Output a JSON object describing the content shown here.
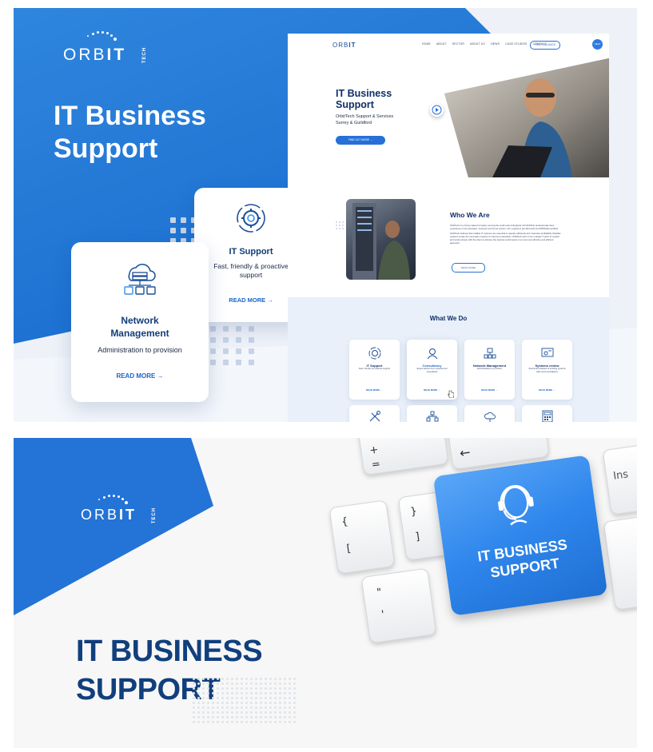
{
  "brand": {
    "logo_word": "ORB",
    "logo_it": "IT",
    "logo_suffix": "TECH"
  },
  "panel1": {
    "hero_title": "IT Business Support",
    "card_it_support": {
      "title": "IT Support",
      "desc": "Fast, friendly & proactive support",
      "read_more": "READ MORE →"
    },
    "card_network": {
      "title": "Network Management",
      "desc": "Administration to provision",
      "read_more": "READ MORE →"
    }
  },
  "mockup": {
    "nav_links": [
      "HOME",
      "ABOUT",
      "SECTOR",
      "ABOUT US",
      "NEWS",
      "CASE STUDIES",
      "CONTACT"
    ],
    "nav_button": "FREE CALLBACK",
    "help_button": "HELP",
    "hero_title": "IT Business Support",
    "hero_subtitle": "OrbitTech Support & Services",
    "hero_location": "Surrey & Guildford",
    "hero_button": "FIND OUT MORE →",
    "who_title": "Who We Are",
    "who_text_1": "OrbitTech is a Surrey based company serving the south east of England. All OrbitTech professionals have experience in the education, business and home sectors. Our engineers are Microsoft and PRINCE2 certified.",
    "who_text_2": "OrbitTech believes that reliable IT systems are essential to operate efficiently and maximise profitability. Reliable systems create the necessary medium to improve productivity. OrbitTech aims to be a single IT point of contact and works closely with the client to achieve the desired performance in a most cost effective and efficient approach.",
    "who_button": "READ MORE",
    "wwd_title": "What We Do",
    "services": [
      {
        "title": "IT Support",
        "desc": "Fast, friendly & proactive support",
        "read": "READ MORE →",
        "icon": "gear-icon"
      },
      {
        "title": "Consultancy",
        "desc": "Expert advice from experienced consultants",
        "read": "READ MORE →",
        "icon": "consultant-icon"
      },
      {
        "title": "Network Management",
        "desc": "Administration to provision",
        "read": "READ MORE →",
        "icon": "network-icon"
      },
      {
        "title": "Systems review",
        "desc": "Structured analysis of existing systems with recommendations",
        "read": "READ MORE →",
        "icon": "systems-icon"
      }
    ]
  },
  "panel2": {
    "title_line1": "IT BUSINESS",
    "title_line2": "SUPPORT",
    "key_line1": "IT BUSINESS",
    "key_line2": "SUPPORT",
    "keyboard_keys": [
      "+",
      "=",
      "{",
      "[",
      "}",
      "]",
      "\"",
      "'",
      "Ins"
    ]
  },
  "colors": {
    "brand_blue": "#1c6fd1",
    "navy": "#133e77",
    "panel_bg": "#eef2f8"
  }
}
